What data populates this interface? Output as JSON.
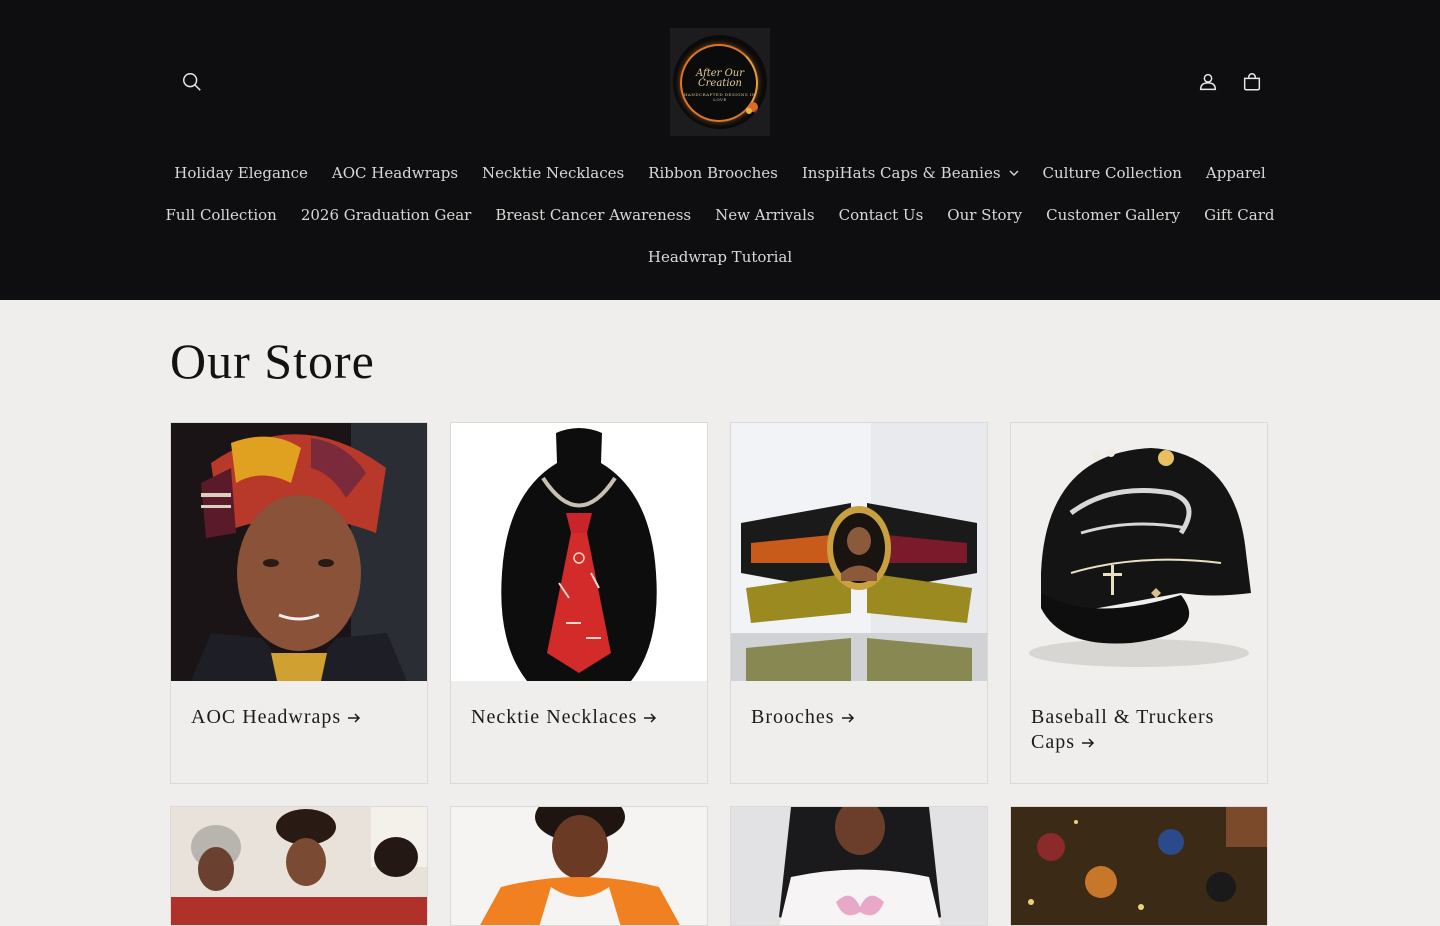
{
  "header": {
    "logo_text": "After Our Creation",
    "logo_subtext": "HANDCRAFTED DESIGNS IN LOVE",
    "icons": {
      "search": "search-icon",
      "account": "account-icon",
      "cart": "cart-icon"
    }
  },
  "nav": {
    "row1": [
      "Holiday Elegance",
      "AOC Headwraps",
      "Necktie Necklaces",
      "Ribbon Brooches",
      "InspiHats Caps & Beanies",
      "Culture Collection",
      "Apparel"
    ],
    "row2": [
      "Full Collection",
      "2026 Graduation Gear",
      "Breast Cancer Awareness",
      "New Arrivals",
      "Contact Us",
      "Our Story",
      "Customer Gallery",
      "Gift Card"
    ],
    "row3": [
      "Headwrap Tutorial"
    ]
  },
  "main": {
    "title": "Our Store",
    "collections": [
      {
        "title": "AOC Headwraps"
      },
      {
        "title": "Necktie Necklaces"
      },
      {
        "title": "Brooches"
      },
      {
        "title": "Baseball & Truckers Caps"
      }
    ]
  },
  "colors": {
    "header_bg": "#0e0e10",
    "page_bg": "#efeeec",
    "accent": "#d9772b"
  }
}
